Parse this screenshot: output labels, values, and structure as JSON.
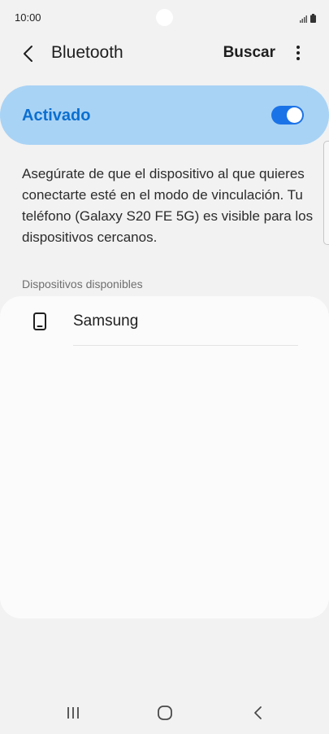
{
  "status_bar": {
    "time": "10:00"
  },
  "app_bar": {
    "title": "Bluetooth",
    "search_label": "Buscar",
    "back_icon": "chevron-left-icon",
    "more_icon": "more-vertical-icon"
  },
  "master_toggle": {
    "label": "Activado",
    "state": "on"
  },
  "description": "Asegúrate de que el dispositivo al que quieres conectarte esté en el modo de vinculación. Tu teléfono (Galaxy S20 FE 5G) es visible para los dispositivos cercanos.",
  "available_devices": {
    "header": "Dispositivos disponibles",
    "items": [
      {
        "name": "Samsung",
        "icon": "phone-icon"
      }
    ]
  },
  "nav_bar": {
    "recents_icon": "recents-icon",
    "home_icon": "home-icon",
    "back_icon": "back-icon"
  },
  "colors": {
    "accent": "#1b73e8",
    "toggle_bar_bg": "#a9d3f5",
    "toggle_label": "#0c6fd0",
    "background": "#f2f2f2",
    "card": "#fbfbfb"
  }
}
